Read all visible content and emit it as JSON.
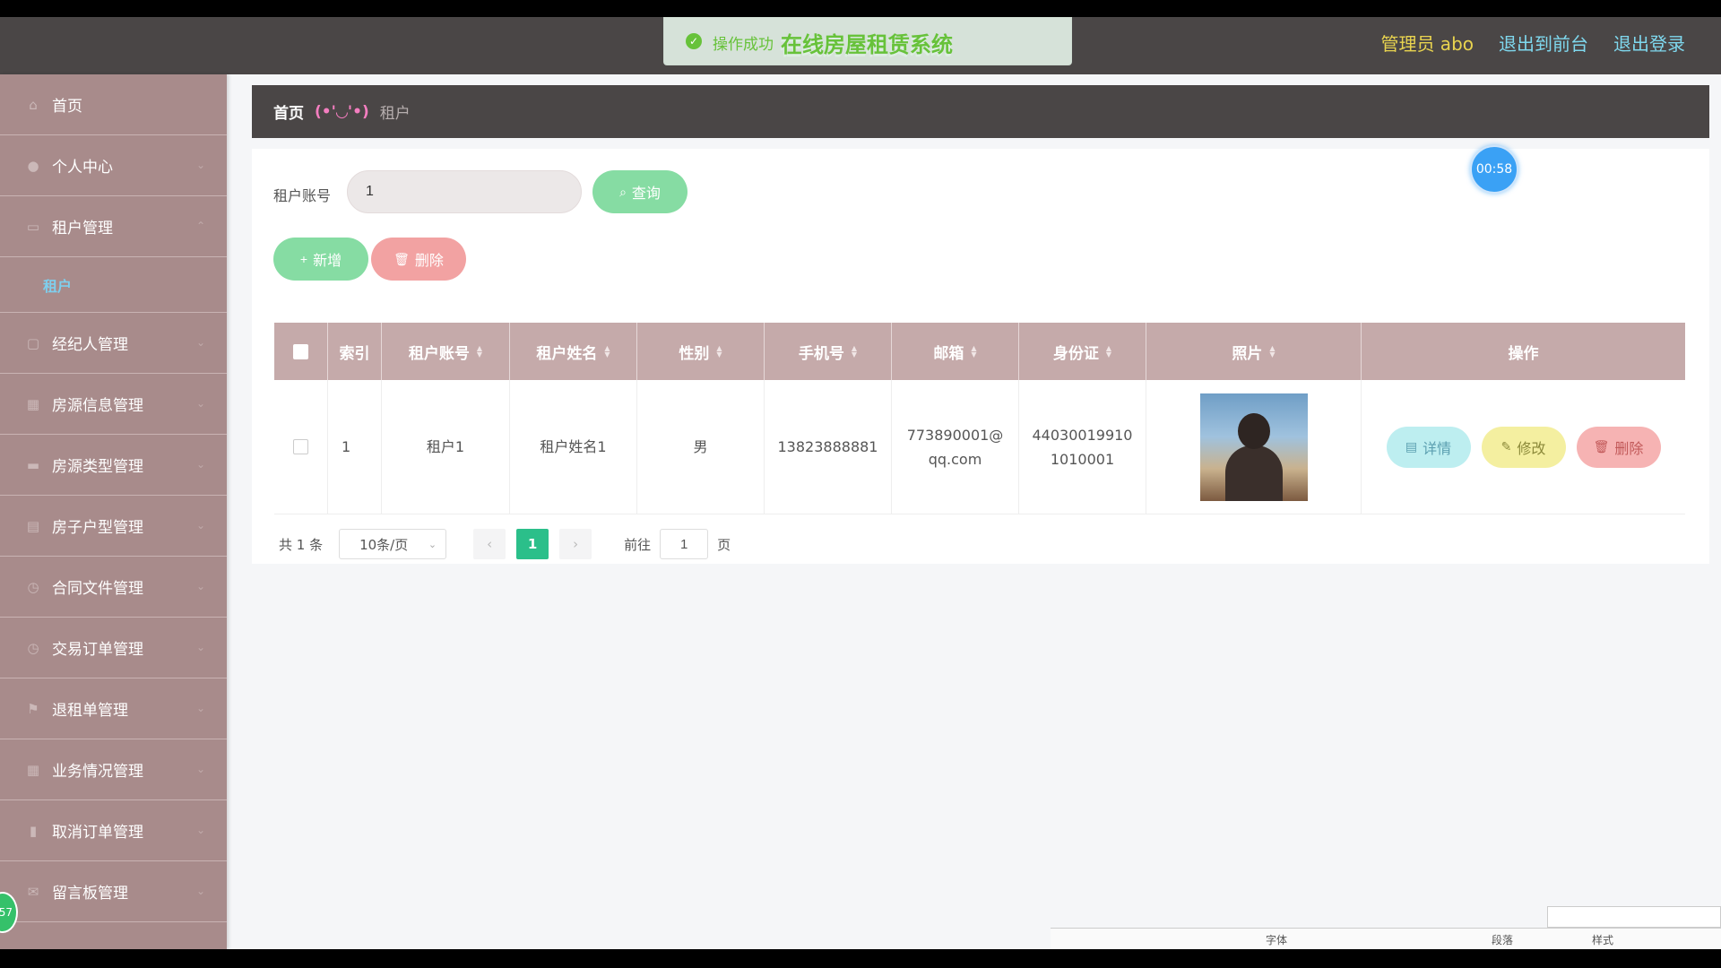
{
  "header": {
    "site_title": "在线房屋租赁系统",
    "toast": {
      "icon": "check-circle-icon",
      "text": "操作成功"
    },
    "admin_label": "管理员 abo",
    "front_link": "退出到前台",
    "logout_link": "退出登录",
    "colors": {
      "bar": "#4a4646",
      "title": "#a8e6c8",
      "admin": "#e9d44f",
      "link": "#7fd8ee"
    }
  },
  "sidebar": {
    "items": [
      {
        "label": "首页",
        "icon": "home-icon",
        "expandable": false
      },
      {
        "label": "个人中心",
        "icon": "user-icon",
        "expandable": true
      },
      {
        "label": "租户管理",
        "icon": "folder-icon",
        "expandable": true,
        "open": true,
        "children": [
          {
            "label": "租户"
          }
        ]
      },
      {
        "label": "经纪人管理",
        "icon": "chat-icon",
        "expandable": true
      },
      {
        "label": "房源信息管理",
        "icon": "building-icon",
        "expandable": true
      },
      {
        "label": "房源类型管理",
        "icon": "monitor-icon",
        "expandable": true
      },
      {
        "label": "房子户型管理",
        "icon": "house-icon",
        "expandable": true
      },
      {
        "label": "合同文件管理",
        "icon": "clock-icon",
        "expandable": true
      },
      {
        "label": "交易订单管理",
        "icon": "clock-icon",
        "expandable": true
      },
      {
        "label": "退租单管理",
        "icon": "flag-icon",
        "expandable": true
      },
      {
        "label": "业务情况管理",
        "icon": "grid-icon",
        "expandable": true
      },
      {
        "label": "取消订单管理",
        "icon": "chart-icon",
        "expandable": true
      },
      {
        "label": "留言板管理",
        "icon": "message-icon",
        "expandable": true
      }
    ],
    "float_badge": "57"
  },
  "breadcrumb": {
    "home": "首页",
    "separator": "(•'◡'•)",
    "current": "租户"
  },
  "search": {
    "label": "租户账号",
    "value": "1",
    "query_button": "查询"
  },
  "actions": {
    "add_button": "新增",
    "delete_button": "删除"
  },
  "table": {
    "columns": [
      "索引",
      "租户账号",
      "租户姓名",
      "性别",
      "手机号",
      "邮箱",
      "身份证",
      "照片",
      "操作"
    ],
    "rows": [
      {
        "index": "1",
        "account": "租户1",
        "name": "租户姓名1",
        "gender": "男",
        "phone": "13823888881",
        "email_line1": "773890001@",
        "email_line2": "qq.com",
        "id_line1": "44030019910",
        "id_line2": "1010001",
        "detail_button": "详情",
        "edit_button": "修改",
        "delete_button": "删除"
      }
    ]
  },
  "pagination": {
    "total": "共 1 条",
    "page_size": "10条/页",
    "current_page": "1",
    "goto_prefix": "前往",
    "goto_value": "1",
    "goto_suffix": "页"
  },
  "timer": "00:58",
  "bottom_toolbar": {
    "items": [
      "字体",
      "段落",
      "样式"
    ]
  }
}
